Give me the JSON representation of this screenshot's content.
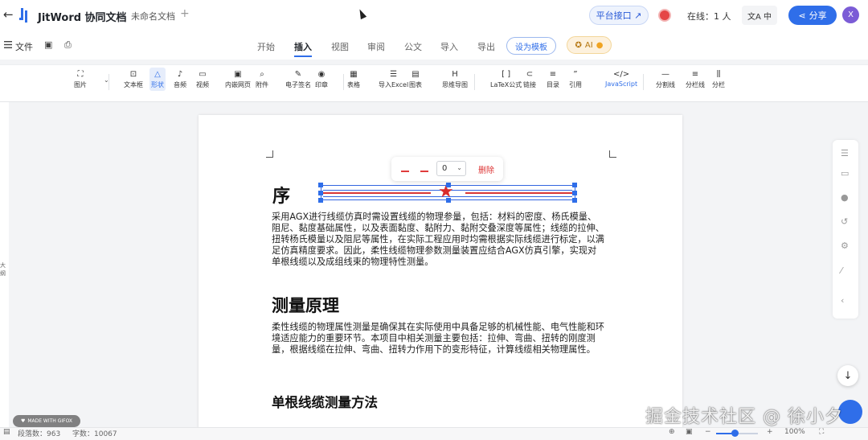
{
  "header": {
    "back_icon": "arrow-left-icon",
    "app_name": "JitWord 协同文档",
    "doc_name": "未命名文档",
    "add_tab": "+",
    "platform_button": "平台接口 ↗",
    "online_label": "在线：1 人",
    "language_label": "中",
    "share_label": "分享",
    "avatar_letter": "X"
  },
  "menu": {
    "file_label": "文件",
    "tabs": [
      "开始",
      "插入",
      "视图",
      "审阅",
      "公文",
      "导入",
      "导出"
    ],
    "active_tab": "插入",
    "template_button": "设为模板",
    "ai_label": "AI"
  },
  "toolbar": {
    "items": [
      {
        "label": "图片",
        "icon": "image-icon"
      },
      {
        "label": "文本框",
        "icon": "textbox-icon"
      },
      {
        "label": "形状",
        "icon": "shape-icon",
        "selected": true
      },
      {
        "label": "音频",
        "icon": "audio-icon"
      },
      {
        "label": "视频",
        "icon": "video-icon"
      },
      {
        "label": "内嵌网页",
        "icon": "webpage-icon"
      },
      {
        "label": "附件",
        "icon": "attachment-icon"
      },
      {
        "label": "电子签名",
        "icon": "signature-icon"
      },
      {
        "label": "印章",
        "icon": "seal-icon"
      },
      {
        "label": "表格",
        "icon": "table-icon"
      },
      {
        "label": "导入Excel",
        "icon": "excel-icon"
      },
      {
        "label": "图表",
        "icon": "chart-icon"
      },
      {
        "label": "思维导图",
        "icon": "mindmap-icon"
      },
      {
        "label": "LaTeX公式",
        "icon": "formula-icon"
      },
      {
        "label": "链接",
        "icon": "link-icon"
      },
      {
        "label": "目录",
        "icon": "toc-icon"
      },
      {
        "label": "引用",
        "icon": "quote-icon"
      },
      {
        "label": "JavaScript",
        "icon": "code-icon"
      },
      {
        "label": "分割线",
        "icon": "divider-icon"
      },
      {
        "label": "分栏线",
        "icon": "column-line-icon"
      },
      {
        "label": "分栏",
        "icon": "columns-icon"
      }
    ]
  },
  "shape_toolbar": {
    "rotation_value": "0",
    "delete_label": "删除",
    "shape_color": "#d92b2b"
  },
  "document": {
    "heading1": "序",
    "para1": "采用AGX进行线缆仿真时需设置线缆的物理参量，包括：材料的密度、杨氏模量、阻尼、黏度基础属性，以及表面黏度、黏附力、黏附交叠深度等属性；线缆的拉伸、扭转杨氏模量以及阻尼等属性，在实际工程应用时均需根据实际线缆进行标定，以满足仿真精度要求。因此，柔性线缆物理参数测量装置应结合AGX仿真引擎，实现对单根线缆以及成组线束的物理特性测量。",
    "heading2": "测量原理",
    "para2": "柔性线缆的物理属性测量是确保其在实际使用中具备足够的机械性能、电气性能和环境适应能力的重要环节。本项目中相关测量主要包括：拉伸、弯曲、扭转的刚度测量，根据线缆在拉伸、弯曲、扭转力作用下的变形特征，计算线缆相关物理属性。",
    "heading3": "单根线缆测量方法"
  },
  "left_strip": "大\n纲",
  "status": {
    "paragraph_count": "段落数：963",
    "word_count": "字数：10067",
    "zoom_level": "100%",
    "zoom_fraction": 0.45
  },
  "badge": "MADE WITH GIFOX",
  "watermark": "掘金技术社区 @ 徐小夕",
  "colors": {
    "accent": "#2f6ee9",
    "danger": "#d93636"
  }
}
